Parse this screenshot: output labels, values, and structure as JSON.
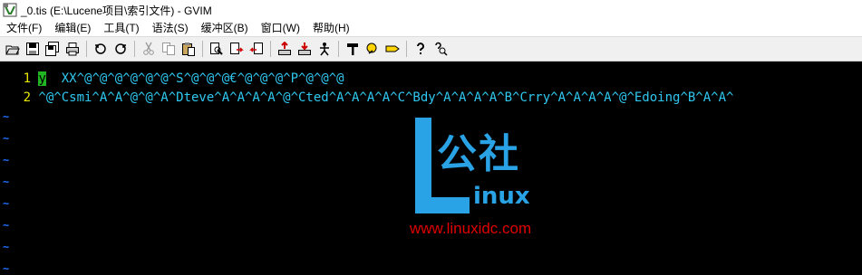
{
  "window": {
    "title": "_0.tis (E:\\Lucene项目\\索引文件) - GVIM"
  },
  "menubar": [
    "文件(F)",
    "编辑(E)",
    "工具(T)",
    "语法(S)",
    "缓冲区(B)",
    "窗口(W)",
    "帮助(H)"
  ],
  "toolbar": {
    "icons": [
      "open-icon",
      "save-icon",
      "save-all-icon",
      "print-icon",
      "undo-icon",
      "redo-icon",
      "cut-icon",
      "copy-icon",
      "paste-icon",
      "find-replace-icon",
      "find-next-icon",
      "find-prev-icon",
      "load-session-icon",
      "save-session-icon",
      "run-script-icon",
      "make-icon",
      "shell-icon",
      "tag-jump-icon",
      "help-icon",
      "find-help-icon"
    ]
  },
  "editor": {
    "lines": [
      {
        "number": "1",
        "cursor_char": "y",
        "text": "  XX^@^@^@^@^@^@^S^@^@^@€^@^@^@^P^@^@^@"
      },
      {
        "number": "2",
        "text": " ^@^Csmi^A^A^@^@^A^Dteve^A^A^A^A^@^Cted^A^A^A^A^C^Bdy^A^A^A^A^B^Crry^A^A^A^A^@^Edoing^B^A^A^"
      }
    ],
    "tilde": "~"
  },
  "watermark": {
    "logo_text": "公社",
    "logo_suffix": "inux",
    "url": "www.linuxidc.com"
  }
}
